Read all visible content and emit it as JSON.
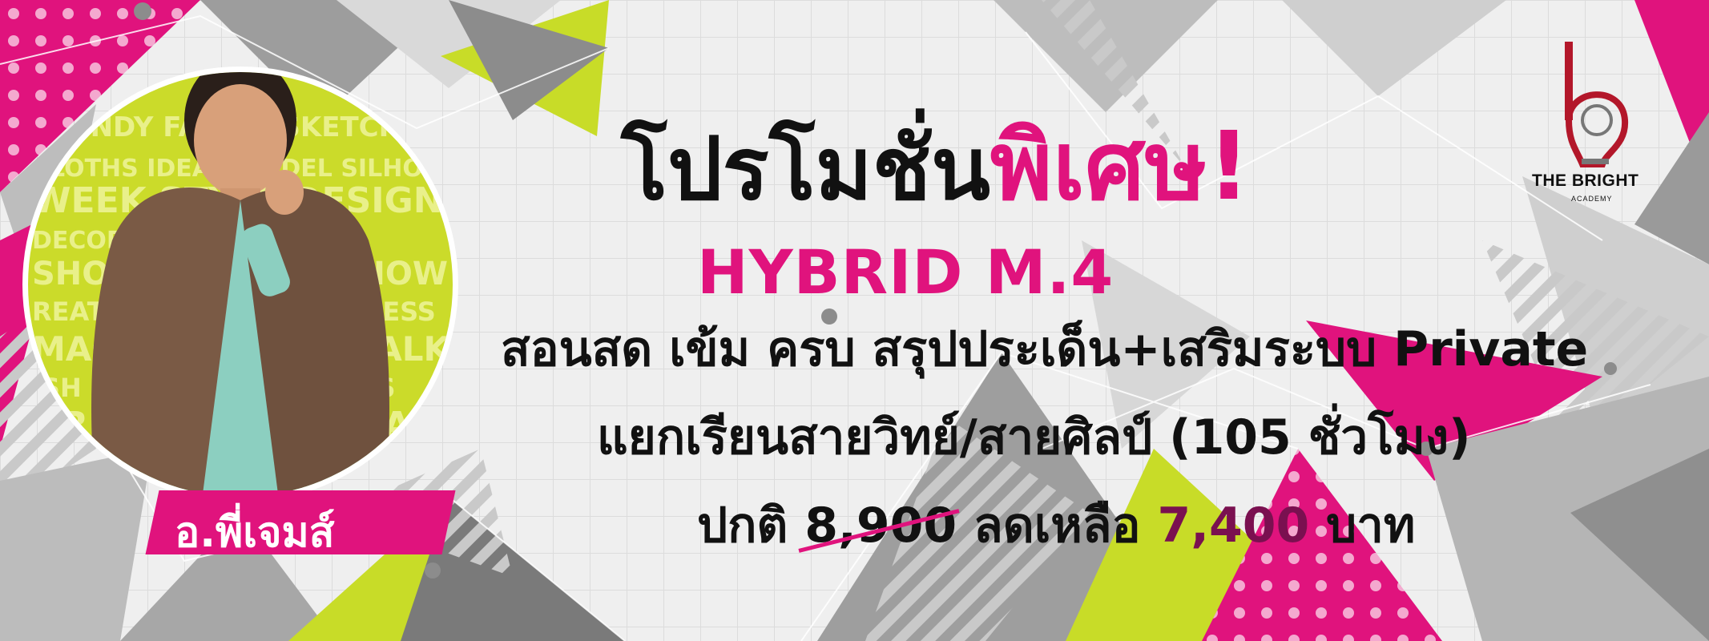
{
  "banner": {
    "headline_main": "โปรโมชั่น",
    "headline_accent": "พิเศษ!",
    "course_name": "HYBRID M.4",
    "line1": "สอนสด เข้ม ครบ สรุปประเด็น+เสริมระบบ Private",
    "line2": "แยกเรียนสายวิทย์/สายศิลป์ (105 ชั่วโมง)",
    "price_prefix": "ปกติ",
    "price_old": "8,900",
    "price_mid": "ลดเหลือ",
    "price_new": "7,400",
    "price_unit": "บาท"
  },
  "teacher": {
    "name": "อ.พี่เจมส์"
  },
  "logo": {
    "title": "THE BRIGHT",
    "subtitle": "ACADEMY"
  },
  "colors": {
    "accent": "#e0137d",
    "lime": "#c8dc28",
    "gray": "#a9a9a9",
    "dark_text": "#111111"
  }
}
